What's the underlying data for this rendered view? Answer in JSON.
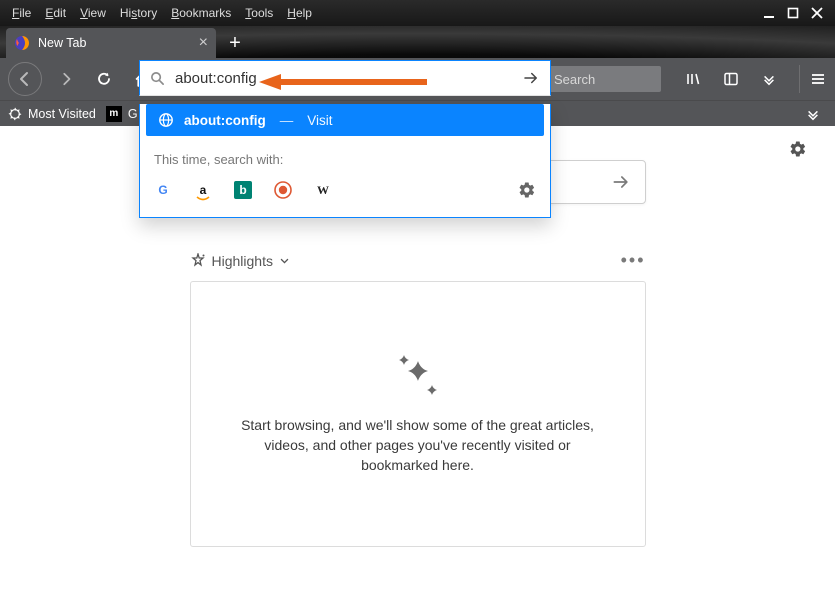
{
  "menu": {
    "file": "File",
    "edit": "Edit",
    "view": "View",
    "history": "History",
    "bookmarks": "Bookmarks",
    "tools": "Tools",
    "help": "Help"
  },
  "tab": {
    "title": "New Tab"
  },
  "urlbar": {
    "value": "about:config"
  },
  "searchbox": {
    "placeholder": "Search"
  },
  "bookmarks": {
    "most_visited": "Most Visited",
    "getting_started_initial": "G"
  },
  "suggestion": {
    "title": "about:config",
    "action": "Visit"
  },
  "searchwith": {
    "label": "This time, search with:"
  },
  "engines": {
    "google": "G",
    "amazon": "a",
    "bing": "b",
    "duckduckgo": "D",
    "wikipedia": "W"
  },
  "highlights": {
    "label": "Highlights"
  },
  "card": {
    "text": "Start browsing, and we'll show some of the great articles, videos, and other pages you've recently visited or bookmarked here."
  }
}
